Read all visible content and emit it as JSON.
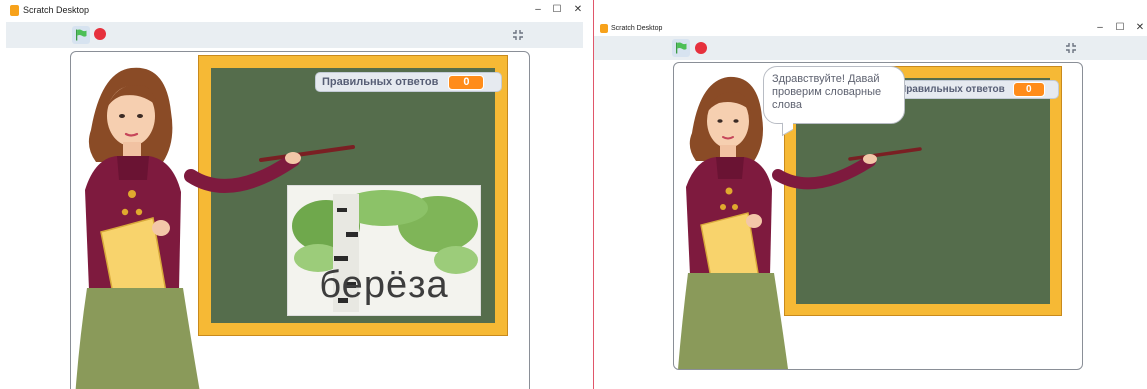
{
  "windows": [
    {
      "title": "Scratch Desktop",
      "window_controls": {
        "minimize": "–",
        "maximize": "☐",
        "close": "✕"
      },
      "monitor": {
        "label": "Правильных ответов",
        "value": "0"
      },
      "word_card": {
        "word": "берёза"
      }
    },
    {
      "title": "Scratch Desktop",
      "window_controls": {
        "minimize": "–",
        "maximize": "☐",
        "close": "✕"
      },
      "monitor": {
        "label": "Правильных ответов",
        "value": "0"
      },
      "speech_bubble": {
        "text": "Здравствуйте! Давай проверим словарные слова"
      }
    }
  ],
  "colors": {
    "flag": "#4cbf56",
    "stop": "#e6313d",
    "board": "#556d4c",
    "board_frame": "#f6b935",
    "counter": "#ff8c1a"
  }
}
